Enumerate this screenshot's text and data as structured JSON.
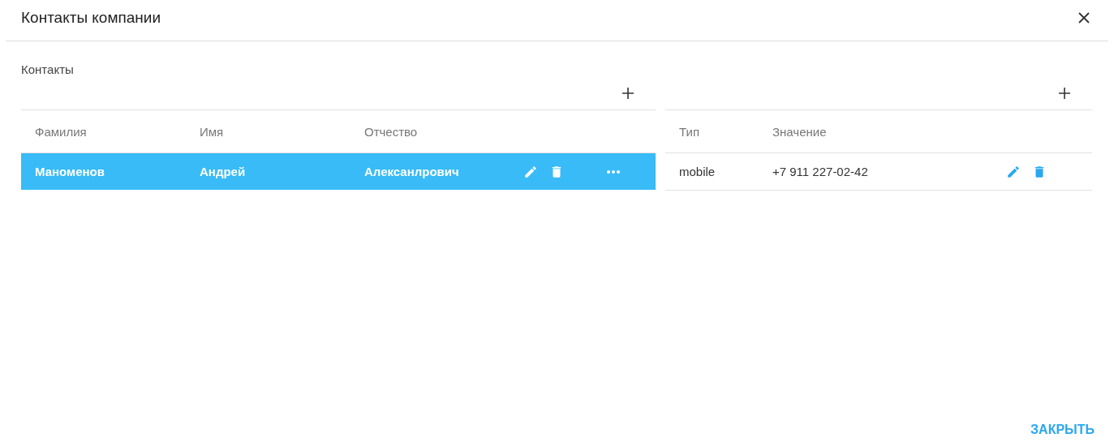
{
  "dialog": {
    "title": "Контакты компании"
  },
  "contacts": {
    "label": "Контакты",
    "columns": [
      "Фамилия",
      "Имя",
      "Отчество"
    ],
    "rows": [
      {
        "cells": [
          "Маноменов",
          "Андрей",
          "Алексанлрович"
        ],
        "selected": true
      }
    ]
  },
  "details": {
    "columns": [
      "Тип",
      "Значение"
    ],
    "rows": [
      {
        "cells": [
          "mobile",
          "+7 911 227-02-42"
        ],
        "selected": false
      }
    ]
  },
  "buttons": [
    "ЗАКРЫТЬ"
  ]
}
